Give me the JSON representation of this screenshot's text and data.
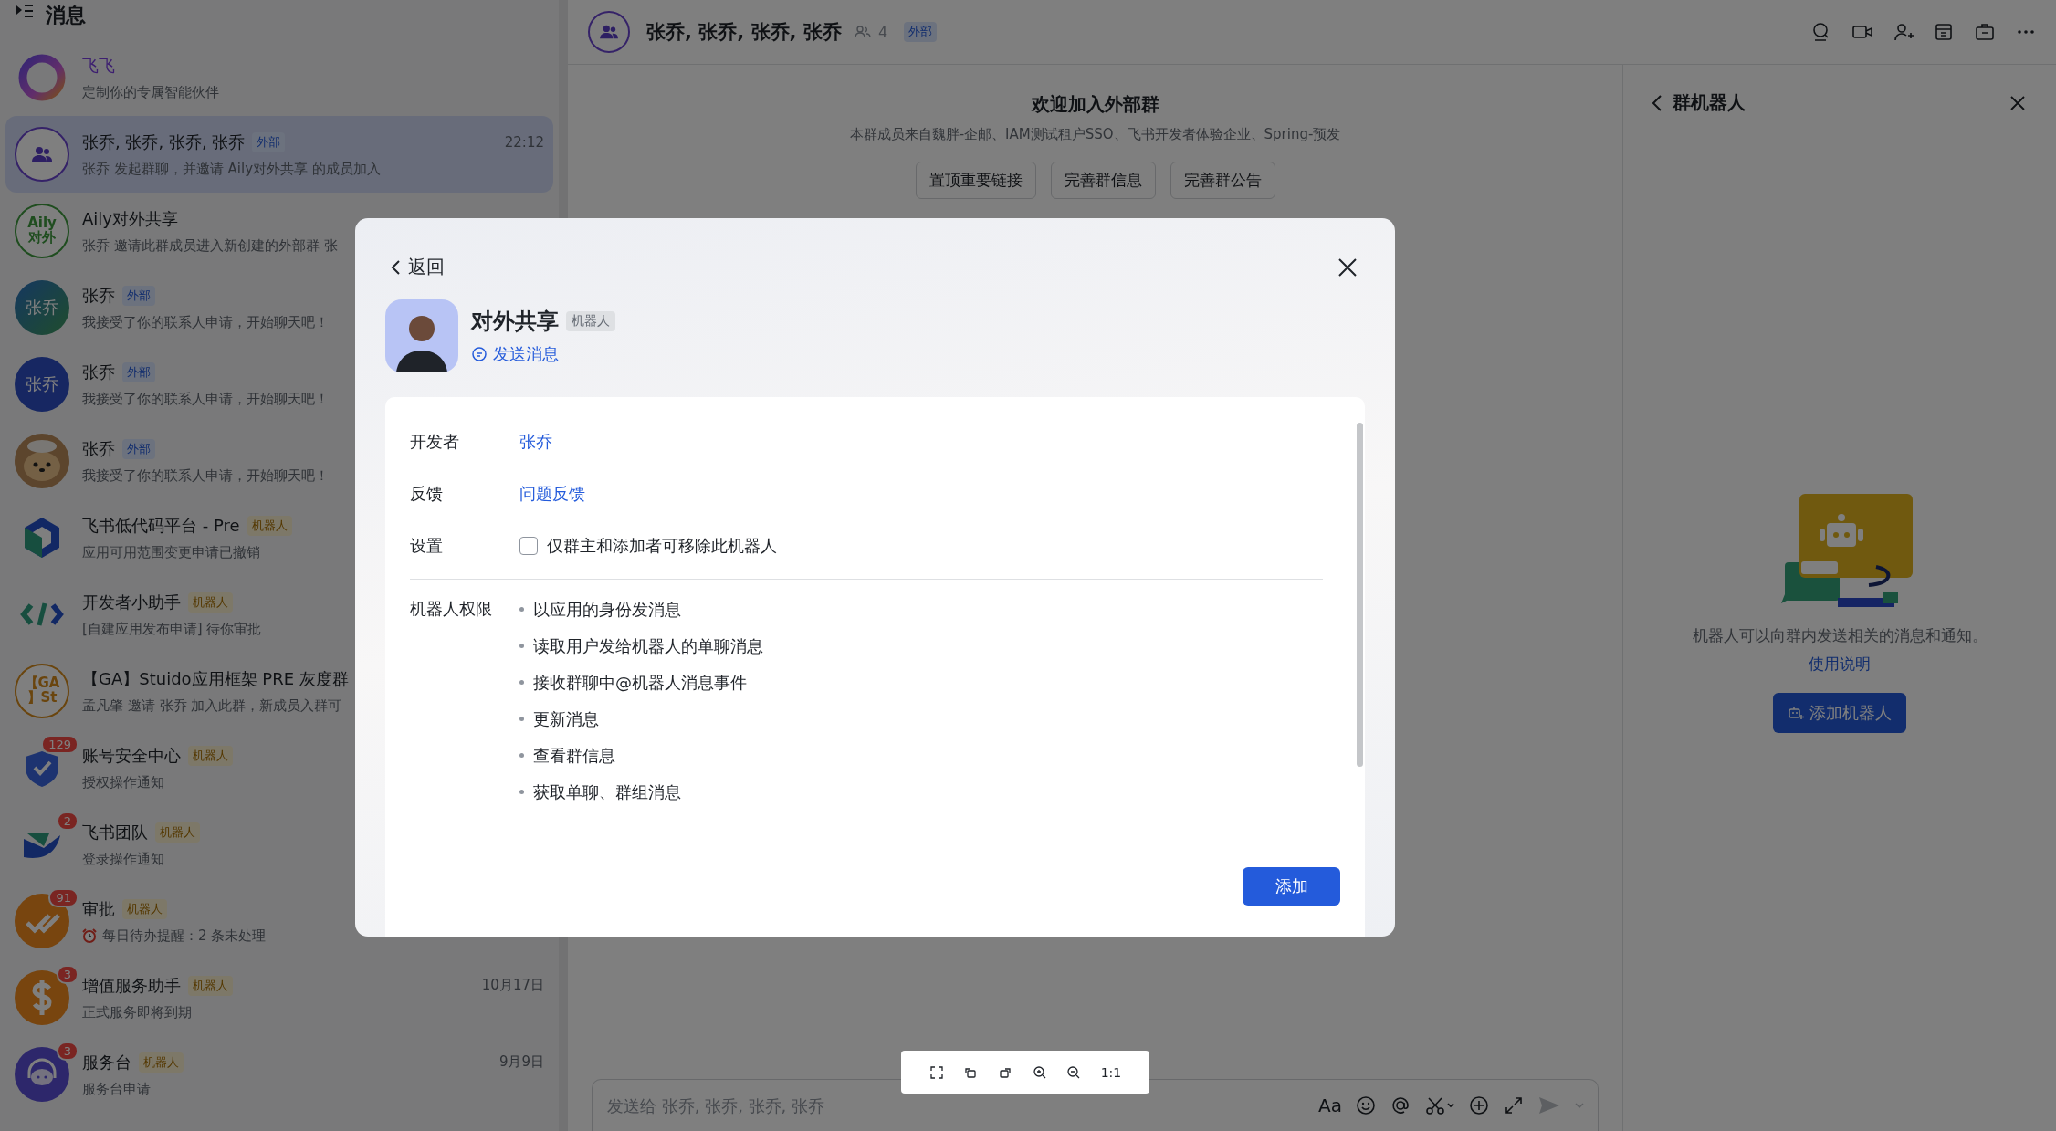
{
  "sidebar": {
    "title": "消息",
    "chats": [
      {
        "name": "飞飞",
        "accent_name": true,
        "avatar": {
          "kind": "ring"
        },
        "preview": "定制你的专属智能伙伴",
        "selected": false
      },
      {
        "name": "张乔, 张乔, 张乔, 张乔",
        "avatar": {
          "kind": "group"
        },
        "badge": {
          "text": "外部",
          "kind": "external"
        },
        "time": "22:12",
        "preview": "张乔 发起群聊，并邀请 Aily对外共享 的成员加入",
        "selected": true
      },
      {
        "name": "Aily对外共享",
        "avatar": {
          "kind": "outline",
          "text": "Aily 对外"
        },
        "preview": "张乔 邀请此群成员进入新创建的外部群 张",
        "selected": false
      },
      {
        "name": "张乔",
        "avatar": {
          "kind": "gradient",
          "text": "张乔"
        },
        "badge": {
          "text": "外部",
          "kind": "external"
        },
        "preview": "我接受了你的联系人申请，开始聊天吧！",
        "selected": false
      },
      {
        "name": "张乔",
        "avatar": {
          "kind": "initials",
          "text": "张乔"
        },
        "badge": {
          "text": "外部",
          "kind": "external"
        },
        "preview": "我接受了你的联系人申请，开始聊天吧！",
        "selected": false
      },
      {
        "name": "张乔",
        "avatar": {
          "kind": "photo"
        },
        "badge": {
          "text": "外部",
          "kind": "external"
        },
        "preview": "我接受了你的联系人申请，开始聊天吧！",
        "selected": false
      },
      {
        "name": "飞书低代码平台 - Pre",
        "avatar": {
          "kind": "hexagon"
        },
        "badge": {
          "text": "机器人",
          "kind": "bot"
        },
        "preview": "应用可用范围变更申请已撤销",
        "selected": false
      },
      {
        "name": "开发者小助手",
        "avatar": {
          "kind": "code"
        },
        "badge": {
          "text": "机器人",
          "kind": "bot"
        },
        "preview": "[自建应用发布申请] 待你审批",
        "selected": false
      },
      {
        "name": "【GA】Stuido应用框架 PRE 灰度群",
        "avatar": {
          "kind": "goldring",
          "text": "【GA 】St"
        },
        "preview": "孟凡肇 邀请 张乔 加入此群，新成员入群可",
        "selected": false
      },
      {
        "name": "账号安全中心",
        "avatar": {
          "kind": "shield"
        },
        "unread": "129",
        "badge": {
          "text": "机器人",
          "kind": "bot"
        },
        "preview": "授权操作通知",
        "selected": false
      },
      {
        "name": "飞书团队",
        "avatar": {
          "kind": "wing"
        },
        "unread": "2",
        "badge": {
          "text": "机器人",
          "kind": "bot"
        },
        "preview": "登录操作通知",
        "selected": false
      },
      {
        "name": "审批",
        "avatar": {
          "kind": "check"
        },
        "unread": "91",
        "badge": {
          "text": "机器人",
          "kind": "bot"
        },
        "alarm": true,
        "preview": "每日待办提醒：2 条未处理",
        "selected": false
      },
      {
        "name": "增值服务助手",
        "avatar": {
          "kind": "dollar"
        },
        "unread": "3",
        "badge": {
          "text": "机器人",
          "kind": "bot"
        },
        "time": "10月17日",
        "preview": "正式服务即将到期",
        "selected": false
      },
      {
        "name": "服务台",
        "avatar": {
          "kind": "service"
        },
        "unread": "3",
        "badge": {
          "text": "机器人",
          "kind": "bot"
        },
        "time": "9月9日",
        "preview": "服务台申请",
        "selected": false
      }
    ]
  },
  "chat_header": {
    "title": "张乔, 张乔, 张乔, 张乔",
    "member_count": "4",
    "badge": "外部"
  },
  "welcome": {
    "title": "欢迎加入外部群",
    "subtitle": "本群成员来自魏胖-企邮、IAM测试租户SSO、飞书开发者体验企业、Spring-预发",
    "buttons": [
      "置顶重要链接",
      "完善群信息",
      "完善群公告"
    ]
  },
  "composer": {
    "placeholder": "发送给 张乔, 张乔, 张乔, 张乔",
    "format_label": "Aa"
  },
  "bot_panel": {
    "title": "群机器人",
    "description": "机器人可以向群内发送相关的消息和通知。",
    "link": "使用说明",
    "button": "添加机器人"
  },
  "modal": {
    "back": "返回",
    "name": "对外共享",
    "tag": "机器人",
    "send": "发送消息",
    "developer": {
      "label": "开发者",
      "value": "张乔"
    },
    "feedback": {
      "label": "反馈",
      "value": "问题反馈"
    },
    "setting": {
      "label": "设置",
      "option": "仅群主和添加者可移除此机器人",
      "checked": false
    },
    "permissions": {
      "label": "机器人权限",
      "items": [
        "以应用的身份发消息",
        "读取用户发给机器人的单聊消息",
        "接收群聊中@机器人消息事件",
        "更新消息",
        "查看群信息",
        "获取单聊、群组消息"
      ]
    },
    "add_button": "添加"
  },
  "image_toolbar": {
    "actual_size": "1:1"
  }
}
